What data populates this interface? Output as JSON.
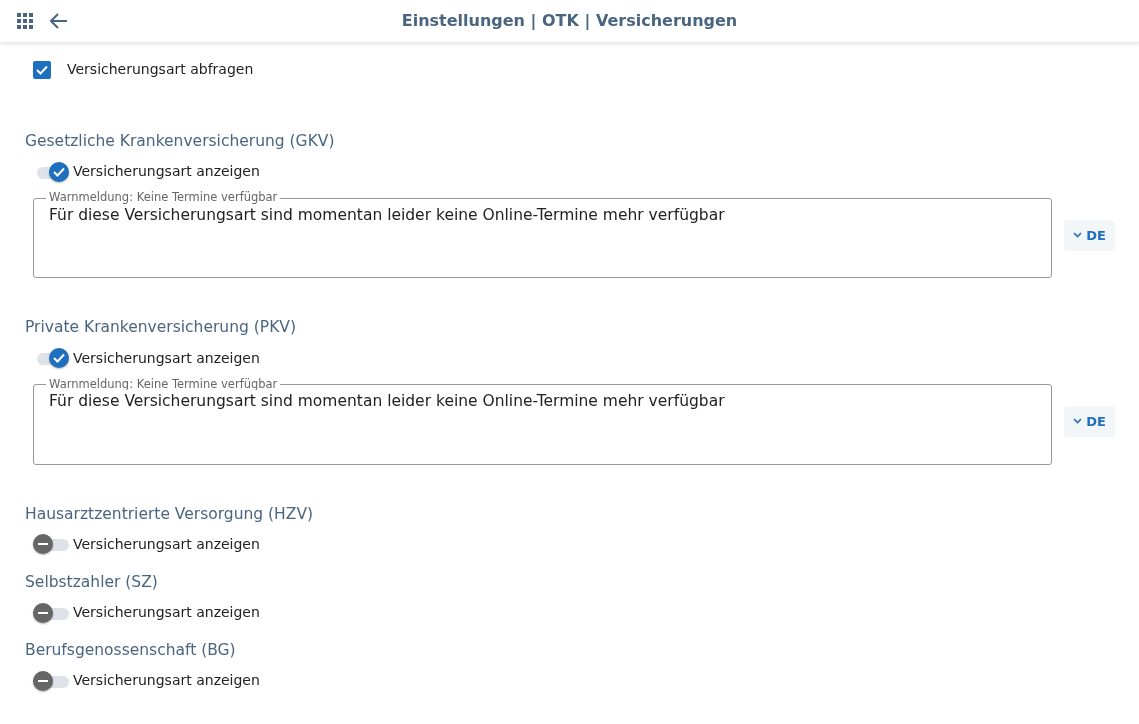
{
  "header": {
    "title": "Einstellungen | OTK | Versicherungen"
  },
  "ask_checkbox": {
    "label": "Versicherungsart abfragen",
    "checked": true
  },
  "sections": [
    {
      "heading": "Gesetzliche Krankenversicherung (GKV)",
      "toggle": {
        "label": "Versicherungsart anzeigen",
        "on": true
      },
      "warning": {
        "label": "Warnmeldung: Keine Termine verfügbar",
        "value": "Für diese Versicherungsart sind momentan leider keine Online-Termine mehr verfügbar",
        "language": "DE"
      }
    },
    {
      "heading": "Private Krankenversicherung (PKV)",
      "toggle": {
        "label": "Versicherungsart anzeigen",
        "on": true
      },
      "warning": {
        "label": "Warnmeldung: Keine Termine verfügbar",
        "value": "Für diese Versicherungsart sind momentan leider keine Online-Termine mehr verfügbar",
        "language": "DE"
      }
    },
    {
      "heading": "Hausarztzentrierte Versorgung (HZV)",
      "toggle": {
        "label": "Versicherungsart anzeigen",
        "on": false
      }
    },
    {
      "heading": "Selbstzahler (SZ)",
      "toggle": {
        "label": "Versicherungsart anzeigen",
        "on": false
      }
    },
    {
      "heading": "Berufsgenossenschaft (BG)",
      "toggle": {
        "label": "Versicherungsart anzeigen",
        "on": false
      }
    }
  ]
}
